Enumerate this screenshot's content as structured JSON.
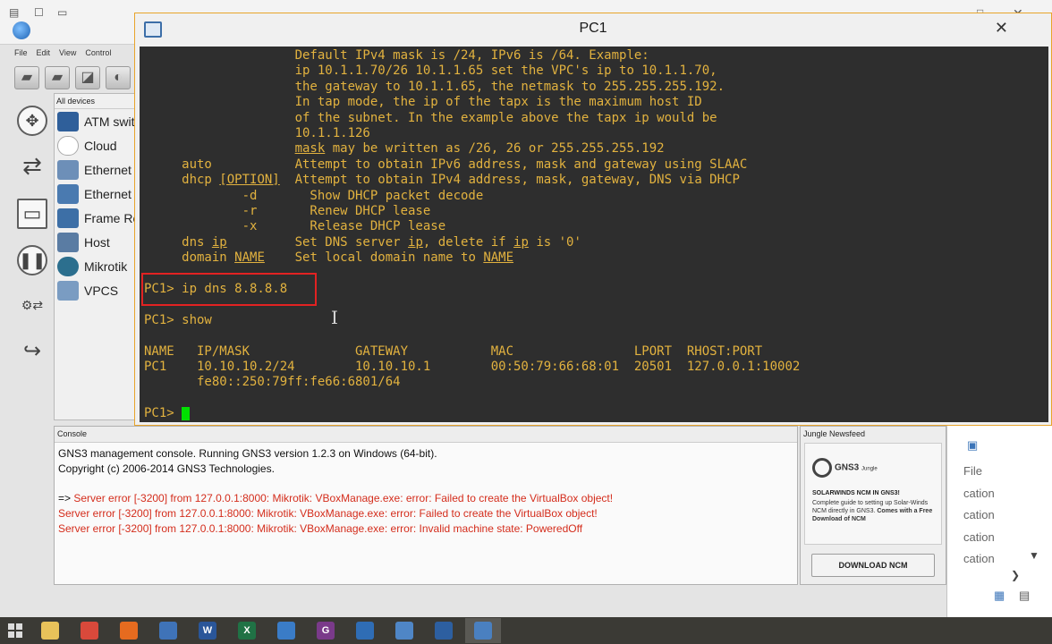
{
  "gns3": {
    "menu": [
      "File",
      "Edit",
      "View",
      "Control"
    ],
    "devices_title": "All devices",
    "devices": [
      {
        "label": "ATM swit",
        "icon": "atm-switch-icon",
        "color": "#2f5f9a"
      },
      {
        "label": "Cloud",
        "icon": "cloud-icon",
        "color": "#ffffff"
      },
      {
        "label": "Ethernet",
        "icon": "ethernet-hub-icon",
        "color": "#6d8fb8"
      },
      {
        "label": "Ethernet",
        "icon": "ethernet-switch-icon",
        "color": "#4a7ab0"
      },
      {
        "label": "Frame Re",
        "icon": "frame-relay-icon",
        "color": "#3d6fa6"
      },
      {
        "label": "Host",
        "icon": "host-icon",
        "color": "#5a7ca3"
      },
      {
        "label": "Mikrotik",
        "icon": "router-icon",
        "color": "#2c6f8e"
      },
      {
        "label": "VPCS",
        "icon": "vpcs-icon",
        "color": "#7a9cc2"
      }
    ],
    "console": {
      "title": "Console",
      "lines": [
        {
          "text": "GNS3 management console. Running GNS3 version 1.2.3 on Windows (64-bit).",
          "color": "black"
        },
        {
          "text": "Copyright (c) 2006-2014 GNS3 Technologies.",
          "color": "black"
        },
        {
          "text": "",
          "color": "blank"
        },
        {
          "prefix": "=> ",
          "text": "Server error [-3200] from 127.0.0.1:8000: Mikrotik: VBoxManage.exe: error: Failed to create the VirtualBox object!",
          "color": "red"
        },
        {
          "text": "Server error [-3200] from 127.0.0.1:8000: Mikrotik: VBoxManage.exe: error: Failed to create the VirtualBox object!",
          "color": "red"
        },
        {
          "text": "Server error [-3200] from 127.0.0.1:8000: Mikrotik: VBoxManage.exe: error: Invalid machine state: PoweredOff",
          "color": "red"
        }
      ]
    },
    "newsfeed": {
      "title": "Jungle Newsfeed",
      "logo": "GNS3",
      "logo_sub": "Jungle",
      "headline": "SOLARWINDS NCM IN GNS3!",
      "body_plain": "Complete guide to setting up Solar-Winds NCM directly in GNS3.",
      "body_bold": "Comes with a Free Download of NCM",
      "button": "DOWNLOAD NCM"
    },
    "side_items": [
      "File",
      "cation",
      "cation",
      "cation",
      "cation"
    ]
  },
  "terminal": {
    "title": "PC1",
    "close": "✕",
    "lines": [
      [
        {
          "t": "                    Default IPv4 mask is /24, IPv6 is /64. Example:"
        }
      ],
      [
        {
          "t": "                    ip 10.1.1.70/26 10.1.1.65 set the VPC's ip to 10.1.1.70,"
        }
      ],
      [
        {
          "t": "                    the gateway to 10.1.1.65, the netmask to 255.255.255.192."
        }
      ],
      [
        {
          "t": "                    In tap mode, the ip of the tapx is the maximum host ID"
        }
      ],
      [
        {
          "t": "                    of the subnet. In the example above the tapx ip would be"
        }
      ],
      [
        {
          "t": "                    10.1.1.126"
        }
      ],
      [
        {
          "t": "                    "
        },
        {
          "t": "mask",
          "u": true
        },
        {
          "t": " may be written as /26, 26 or 255.255.255.192"
        }
      ],
      [
        {
          "t": "     auto           Attempt to obtain IPv6 address, mask and gateway using SLAAC"
        }
      ],
      [
        {
          "t": "     dhcp "
        },
        {
          "t": "[OPTION]",
          "u": true
        },
        {
          "t": "  Attempt to obtain IPv4 address, mask, gateway, DNS via DHCP"
        }
      ],
      [
        {
          "t": "             -d       Show DHCP packet decode"
        }
      ],
      [
        {
          "t": "             -r       Renew DHCP lease"
        }
      ],
      [
        {
          "t": "             -x       Release DHCP lease"
        }
      ],
      [
        {
          "t": "     dns "
        },
        {
          "t": "ip",
          "u": true
        },
        {
          "t": "         Set DNS server "
        },
        {
          "t": "ip",
          "u": true
        },
        {
          "t": ", delete if "
        },
        {
          "t": "ip",
          "u": true
        },
        {
          "t": " is '0'"
        }
      ],
      [
        {
          "t": "     domain "
        },
        {
          "t": "NAME",
          "u": true
        },
        {
          "t": "    Set local domain name to "
        },
        {
          "t": "NAME",
          "u": true
        }
      ],
      [
        {
          "t": ""
        }
      ],
      [
        {
          "t": "PC1> ip dns 8.8.8.8"
        }
      ],
      [
        {
          "t": ""
        }
      ],
      [
        {
          "t": "PC1> show"
        }
      ],
      [
        {
          "t": ""
        }
      ],
      [
        {
          "t": "NAME   IP/MASK              GATEWAY           MAC                LPORT  RHOST:PORT"
        }
      ],
      [
        {
          "t": "PC1    10.10.10.2/24        10.10.10.1        00:50:79:66:68:01  20501  127.0.0.1:10002"
        }
      ],
      [
        {
          "t": "       fe80::250:79ff:fe66:6801/64"
        }
      ],
      [
        {
          "t": ""
        }
      ],
      [
        {
          "t": "PC1> "
        },
        {
          "cursor": true
        }
      ]
    ]
  },
  "taskbar": {
    "apps": [
      {
        "name": "file-explorer-icon",
        "glyph": "",
        "color": "#e8c25a",
        "active": false
      },
      {
        "name": "chrome-icon",
        "glyph": "",
        "color": "#d9493b",
        "active": false
      },
      {
        "name": "firefox-icon",
        "glyph": "",
        "color": "#e66b1f",
        "active": false
      },
      {
        "name": "network-icon",
        "glyph": "",
        "color": "#3f73b8",
        "active": false
      },
      {
        "name": "word-icon",
        "glyph": "W",
        "color": "#2a5699",
        "active": false
      },
      {
        "name": "excel-icon",
        "glyph": "X",
        "color": "#207245",
        "active": false
      },
      {
        "name": "app-blue-icon",
        "glyph": "",
        "color": "#3a7cc7",
        "active": false
      },
      {
        "name": "app-purple-icon",
        "glyph": "G",
        "color": "#7a3a8a",
        "active": false
      },
      {
        "name": "gns3-icon",
        "glyph": "",
        "color": "#2f6db5",
        "active": false
      },
      {
        "name": "remote-desktop-icon",
        "glyph": "",
        "color": "#4f86c6",
        "active": false
      },
      {
        "name": "virtualbox-icon",
        "glyph": "",
        "color": "#2d5fa0",
        "active": false
      },
      {
        "name": "vpcs-terminal-icon",
        "glyph": "",
        "color": "#4a80c0",
        "active": true
      }
    ]
  }
}
